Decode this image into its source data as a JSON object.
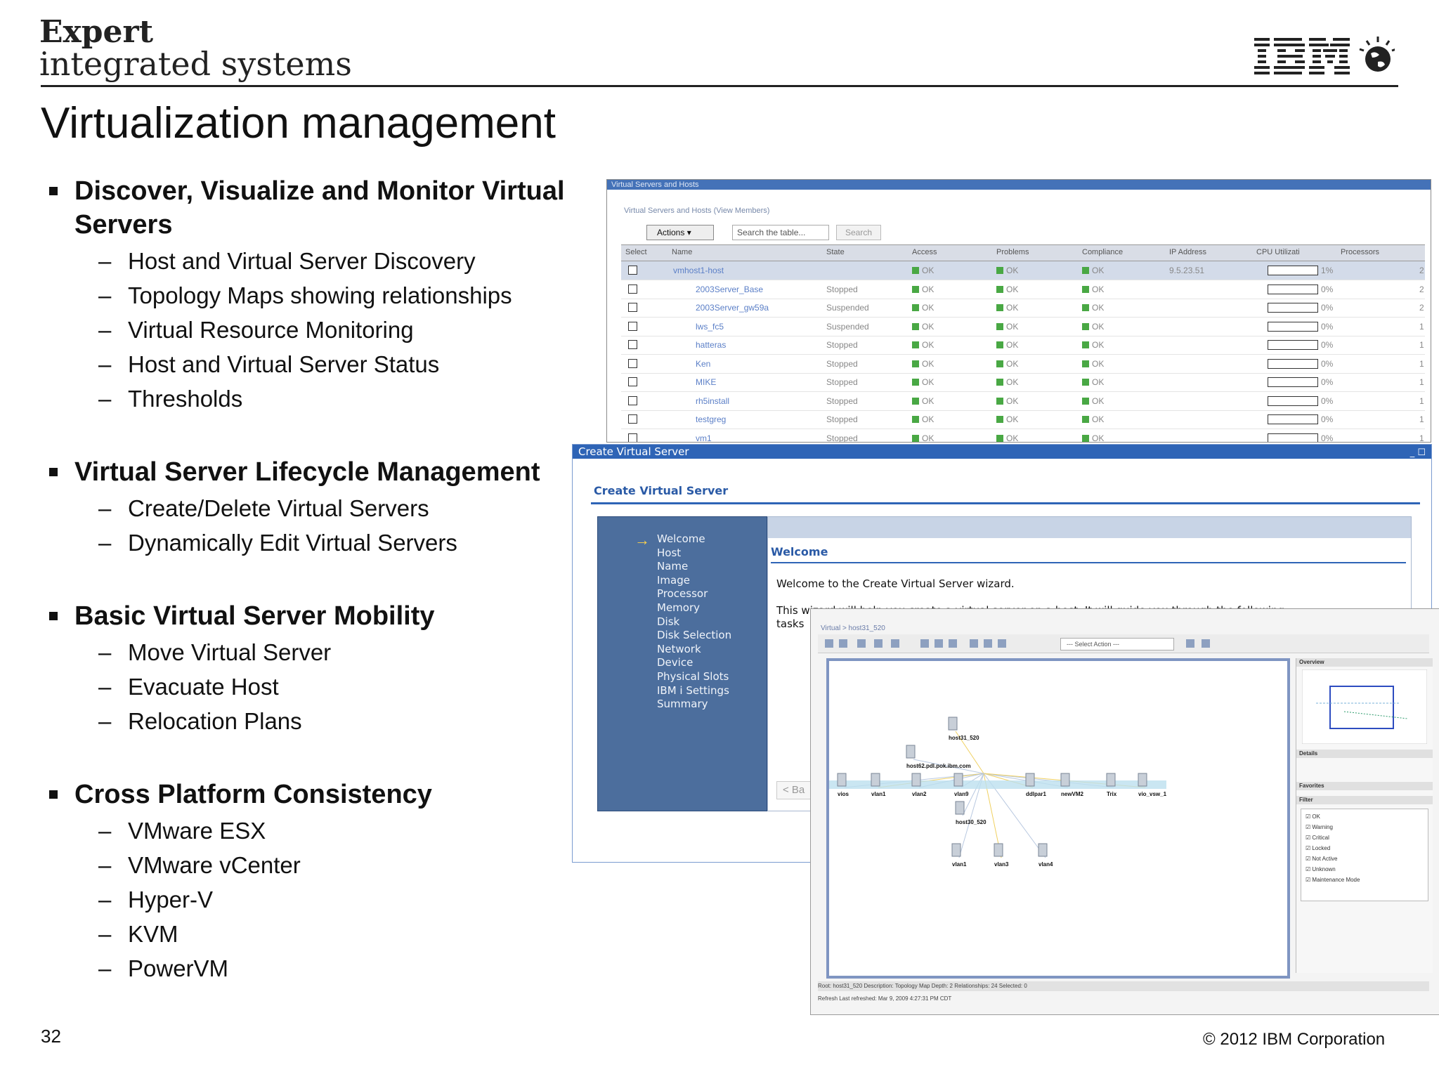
{
  "header": {
    "logo_line1": "Expert",
    "logo_line2": "integrated systems",
    "brand": "IBM"
  },
  "slide": {
    "title": "Virtualization management",
    "page_number": "32",
    "copyright": "© 2012 IBM Corporation"
  },
  "sections": [
    {
      "heading_line1": "Discover, Visualize and Monitor Virtual",
      "heading_line2": "Servers",
      "items": [
        "Host and Virtual Server Discovery",
        "Topology Maps showing relationships",
        "Virtual Resource Monitoring",
        "Host and Virtual Server Status",
        "Thresholds"
      ]
    },
    {
      "heading_line1": "Virtual Server Lifecycle Management",
      "items": [
        "Create/Delete Virtual Servers",
        "Dynamically Edit Virtual Servers"
      ]
    },
    {
      "heading_line1": "Basic Virtual Server Mobility",
      "items": [
        "Move Virtual Server",
        "Evacuate Host",
        "Relocation Plans"
      ]
    },
    {
      "heading_line1": "Cross Platform Consistency",
      "items": [
        "VMware ESX",
        "VMware vCenter",
        "Hyper-V",
        "KVM",
        "PowerVM"
      ]
    }
  ],
  "vsh_window": {
    "title": "Virtual Servers and Hosts",
    "subtitle": "Virtual Servers and Hosts (View Members)",
    "actions_label": "Actions",
    "search_placeholder": "Search the table...",
    "search_button": "Search",
    "columns": [
      "Select",
      "Name",
      "State",
      "Access",
      "Problems",
      "Compliance",
      "IP Address",
      "CPU Utilizati",
      "Processors"
    ],
    "rows": [
      {
        "name": "vmhost1-host",
        "state": "",
        "access": "OK",
        "problems": "OK",
        "compliance": "OK",
        "ip": "9.5.23.51",
        "cpu": "1%",
        "processors": "2"
      },
      {
        "name": "2003Server_Base",
        "state": "Stopped",
        "access": "OK",
        "problems": "OK",
        "compliance": "OK",
        "ip": "",
        "cpu": "0%",
        "processors": "2"
      },
      {
        "name": "2003Server_gw59a",
        "state": "Suspended",
        "access": "OK",
        "problems": "OK",
        "compliance": "OK",
        "ip": "",
        "cpu": "0%",
        "processors": "2"
      },
      {
        "name": "lws_fc5",
        "state": "Suspended",
        "access": "OK",
        "problems": "OK",
        "compliance": "OK",
        "ip": "",
        "cpu": "0%",
        "processors": "1"
      },
      {
        "name": "hatteras",
        "state": "Stopped",
        "access": "OK",
        "problems": "OK",
        "compliance": "OK",
        "ip": "",
        "cpu": "0%",
        "processors": "1"
      },
      {
        "name": "Ken",
        "state": "Stopped",
        "access": "OK",
        "problems": "OK",
        "compliance": "OK",
        "ip": "",
        "cpu": "0%",
        "processors": "1"
      },
      {
        "name": "MIKE",
        "state": "Stopped",
        "access": "OK",
        "problems": "OK",
        "compliance": "OK",
        "ip": "",
        "cpu": "0%",
        "processors": "1"
      },
      {
        "name": "rh5install",
        "state": "Stopped",
        "access": "OK",
        "problems": "OK",
        "compliance": "OK",
        "ip": "",
        "cpu": "0%",
        "processors": "1"
      },
      {
        "name": "testgreg",
        "state": "Stopped",
        "access": "OK",
        "problems": "OK",
        "compliance": "OK",
        "ip": "",
        "cpu": "0%",
        "processors": "1"
      },
      {
        "name": "vm1",
        "state": "Stopped",
        "access": "OK",
        "problems": "OK",
        "compliance": "OK",
        "ip": "",
        "cpu": "0%",
        "processors": "1"
      }
    ]
  },
  "cvs_window": {
    "title": "Create Virtual Server",
    "heading": "Create Virtual Server",
    "nav": [
      "Welcome",
      "Host",
      "Name",
      "Image",
      "Processor",
      "Memory",
      "Disk",
      "Disk Selection",
      "Network",
      "Device",
      "Physical Slots",
      "IBM i Settings",
      "Summary"
    ],
    "welcome_title": "Welcome",
    "welcome_text": "Welcome to the Create Virtual Server wizard.",
    "intro_line1": "This wizard will help you create a virtual server on a host. It will guide you through the following",
    "intro_line2": "tasks",
    "back_label": "< Ba"
  },
  "topo_window": {
    "crumb": "Virtual > host31_520",
    "select_action": "--- Select Action ---",
    "nodes": [
      "host31_520",
      "host62.pdl.pok.ibm.com",
      "vios",
      "vlan1",
      "vlan2",
      "vlan9",
      "ddlpar1",
      "newVM2",
      "Trix",
      "vio_vsw_1",
      "host30_520",
      "vlan1",
      "vlan3",
      "vlan4"
    ],
    "overview": "Overview",
    "details": "Details",
    "favorites": "Favorites",
    "filter": "Filter",
    "status_items": [
      "OK",
      "Warning",
      "Critical",
      "Locked",
      "Not Active",
      "Unknown",
      "Maintenance Mode"
    ],
    "status_bar": "Root: host31_520   Description: Topology Map   Depth: 2   Relationships: 24   Selected: 0",
    "refresh_bar": "Refresh   Last refreshed: Mar 9, 2009 4:27:31 PM CDT"
  },
  "colors": {
    "titlebar": "#2e64b6",
    "nav_panel": "#4c6e9d",
    "ok_green": "#49a844"
  }
}
